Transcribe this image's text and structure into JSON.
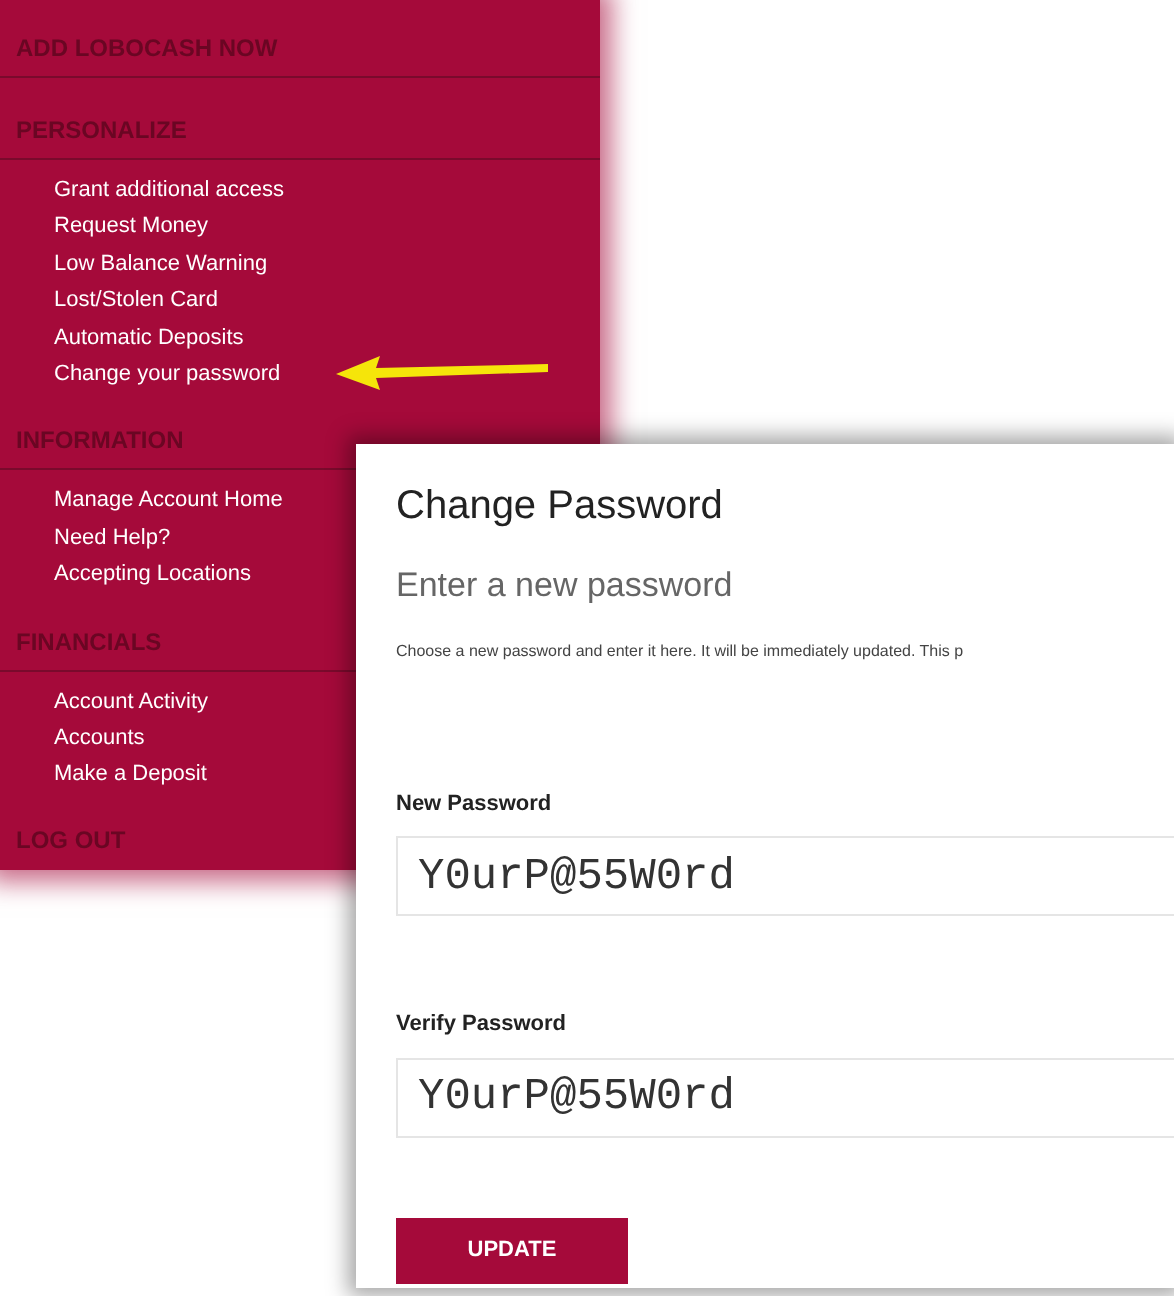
{
  "menu": {
    "sections": [
      {
        "heading": "ADD LOBOCASH NOW"
      },
      {
        "heading": "PERSONALIZE",
        "items": [
          "Grant additional access",
          "Request Money",
          "Low Balance Warning",
          "Lost/Stolen Card",
          "Automatic Deposits",
          "Change your password"
        ]
      },
      {
        "heading": "INFORMATION",
        "items": [
          "Manage Account Home",
          "Need Help?",
          "Accepting Locations"
        ]
      },
      {
        "heading": "FINANCIALS",
        "items": [
          "Account Activity",
          "Accounts",
          "Make a Deposit"
        ]
      },
      {
        "heading": "LOG OUT"
      }
    ]
  },
  "card": {
    "title": "Change Password",
    "subtitle": "Enter a new password",
    "description": "Choose a new password and enter it here. It will be immediately updated. This p",
    "fields": [
      {
        "label": "New Password",
        "value": "Y0urP@55W0rd"
      },
      {
        "label": "Verify Password",
        "value": "Y0urP@55W0rd"
      }
    ],
    "button": "UPDATE"
  }
}
